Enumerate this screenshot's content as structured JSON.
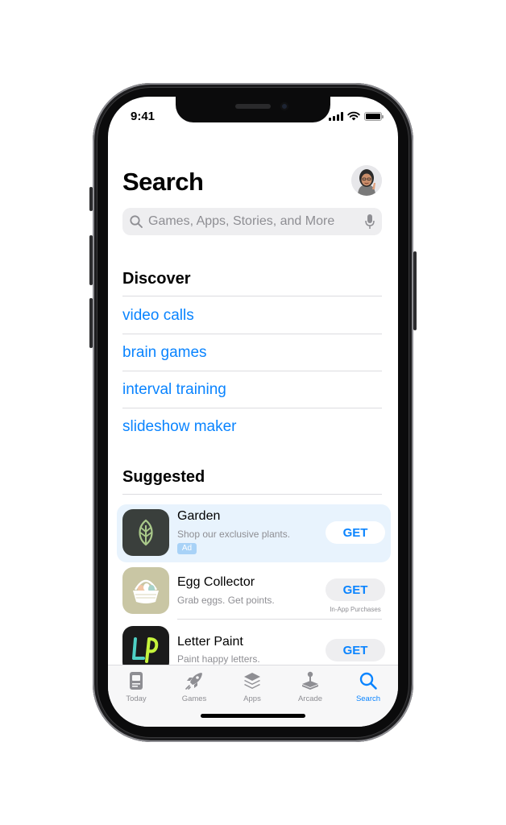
{
  "status_bar": {
    "time": "9:41"
  },
  "header": {
    "title": "Search"
  },
  "search": {
    "placeholder": "Games, Apps, Stories, and More"
  },
  "discover": {
    "heading": "Discover",
    "items": [
      "video calls",
      "brain games",
      "interval training",
      "slideshow maker"
    ]
  },
  "suggested": {
    "heading": "Suggested",
    "apps": [
      {
        "name": "Garden",
        "subtitle": "Shop our exclusive plants.",
        "badge": "Ad",
        "button": "GET"
      },
      {
        "name": "Egg Collector",
        "subtitle": "Grab eggs. Get points.",
        "button": "GET",
        "note": "In-App Purchases"
      },
      {
        "name": "Letter Paint",
        "subtitle": "Paint happy letters.",
        "button": "GET"
      }
    ]
  },
  "tabbar": {
    "tabs": [
      {
        "label": "Today",
        "icon": "today-icon"
      },
      {
        "label": "Games",
        "icon": "rocket-icon"
      },
      {
        "label": "Apps",
        "icon": "apps-stack-icon"
      },
      {
        "label": "Arcade",
        "icon": "joystick-icon"
      },
      {
        "label": "Search",
        "icon": "search-icon",
        "active": true
      }
    ]
  },
  "colors": {
    "accent": "#0a84ff",
    "ad_background": "#e8f3fd",
    "garden_icon_bg": "#3a3f3c",
    "egg_icon_bg": "#c9c6a4",
    "letter_icon_bg": "#1b1b1b"
  }
}
